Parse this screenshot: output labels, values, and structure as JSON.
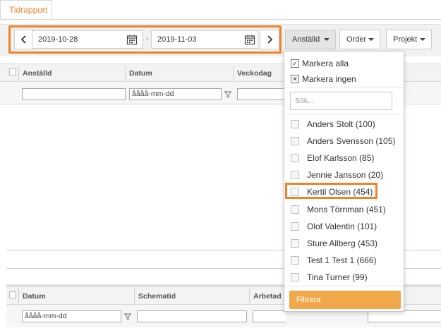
{
  "tab": {
    "label": "Tidrapport"
  },
  "toolbar": {
    "date_from": "2019-10-28",
    "date_to": "2019-11-03",
    "date_separator": "-",
    "dropdowns": [
      {
        "label": "Anställd"
      },
      {
        "label": "Order"
      },
      {
        "label": "Projekt"
      }
    ]
  },
  "grid_top": {
    "columns": [
      "Anställd",
      "Datum",
      "Veckodag"
    ],
    "date_placeholder": "åååå-mm-dd"
  },
  "grid_bottom": {
    "columns": [
      "Datum",
      "Schematid",
      "Arbetad sc"
    ],
    "date_placeholder": "åååå-mm-dd"
  },
  "employee_dropdown": {
    "select_all": "Markera alla",
    "select_none": "Markera ingen",
    "search_placeholder": "Sök...",
    "employees": [
      "Anders Stolt (100)",
      "Anders Svensson (105)",
      "Elof Karlsson (85)",
      "Jennie Jansson (20)",
      "Kertil Olsen (454)",
      "Mons Törnman (451)",
      "Olof Valentin (101)",
      "Sture Allberg (453)",
      "Test 1 Test 1 (666)",
      "Tina Turner (99)"
    ],
    "highlighted_employee": "Kertil Olsen (454)",
    "filter_button": "Filtrera"
  },
  "colors": {
    "accent": "#f0832a",
    "filter_button": "#f0a848"
  }
}
